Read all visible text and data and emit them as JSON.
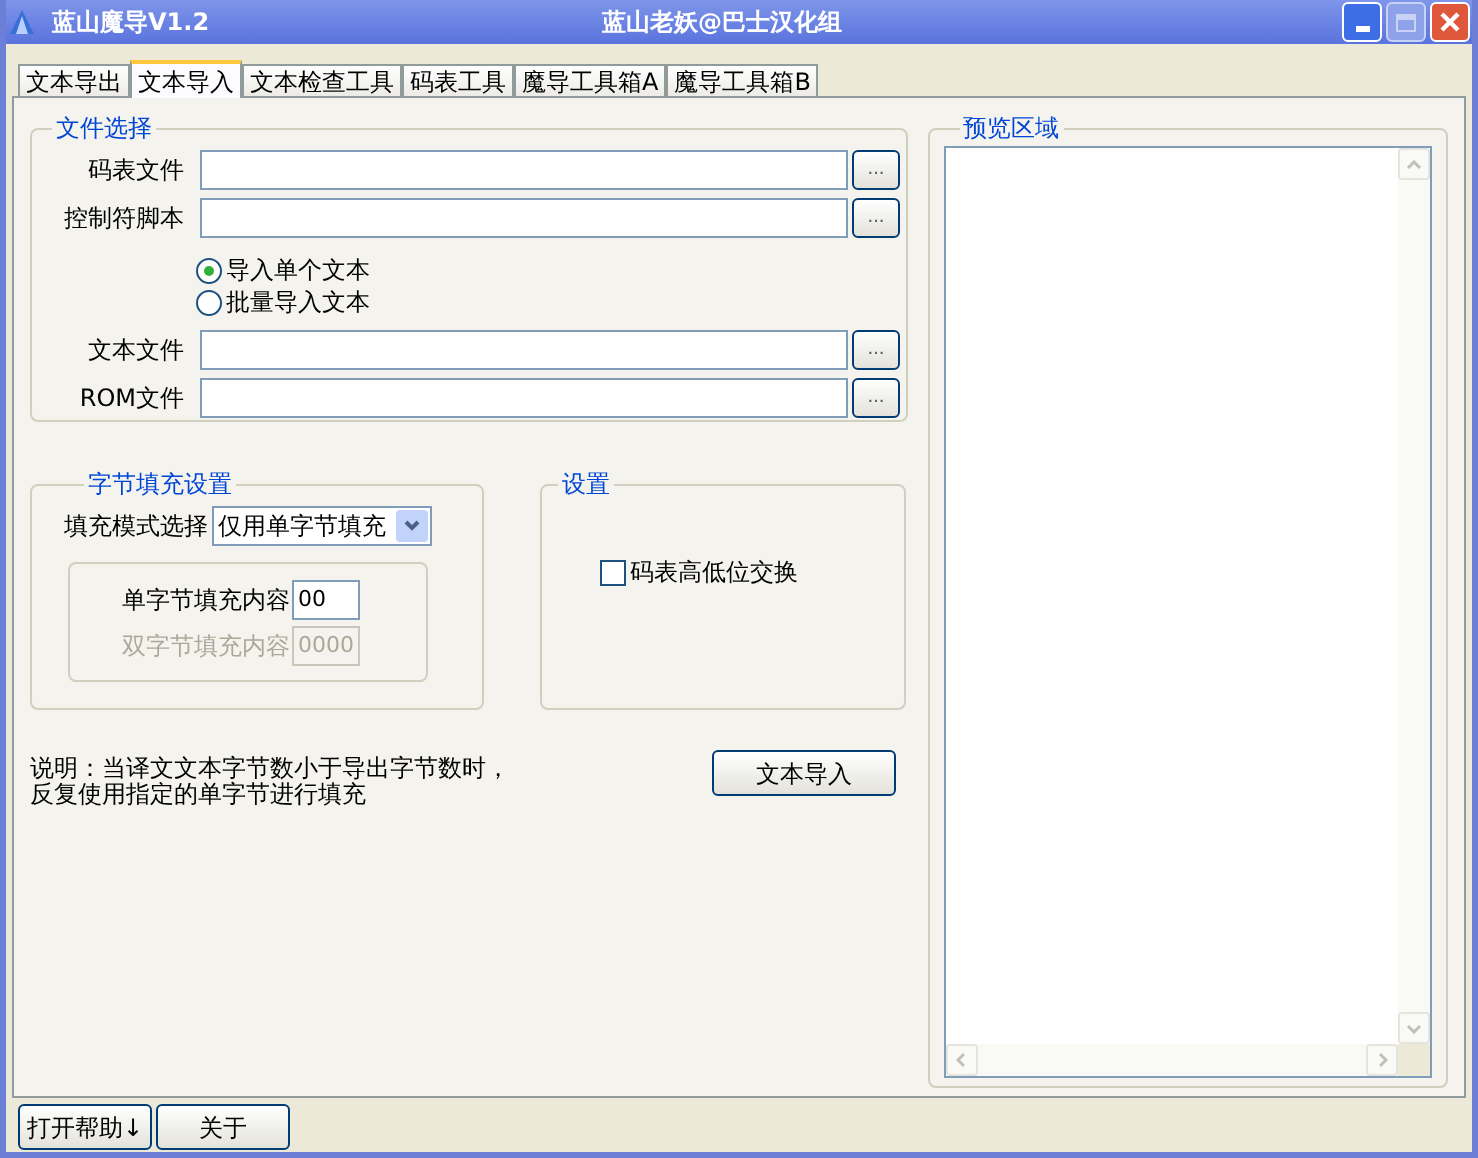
{
  "window": {
    "title": "蓝山魔导V1.2",
    "subtitle": "蓝山老妖@巴士汉化组"
  },
  "tabs": [
    {
      "label": "文本导出",
      "selected": false
    },
    {
      "label": "文本导入",
      "selected": true
    },
    {
      "label": "文本检查工具",
      "selected": false
    },
    {
      "label": "码表工具",
      "selected": false
    },
    {
      "label": "魔导工具箱A",
      "selected": false
    },
    {
      "label": "魔导工具箱B",
      "selected": false
    }
  ],
  "file_group": {
    "title": "文件选择",
    "fields_top": [
      {
        "label": "码表文件",
        "button": "..."
      },
      {
        "label": "控制符脚本",
        "button": "..."
      }
    ],
    "radios": [
      {
        "label": "导入单个文本",
        "selected": true
      },
      {
        "label": "批量导入文本",
        "selected": false
      }
    ],
    "fields_bottom": [
      {
        "label": "文本文件",
        "button": "..."
      },
      {
        "label": "ROM文件",
        "button": "..."
      }
    ]
  },
  "fill_group": {
    "title": "字节填充设置",
    "mode_label": "填充模式选择",
    "mode_value": "仅用单字节填充",
    "fields": [
      {
        "label": "单字节填充内容",
        "value": "00",
        "disabled": false
      },
      {
        "label": "双字节填充内容",
        "value": "0000",
        "disabled": true
      }
    ]
  },
  "settings_group": {
    "title": "设置",
    "checkbox": {
      "label": "码表高低位交换",
      "checked": false
    }
  },
  "note": [
    "说明：当译文文本字节数小于导出字节数时，",
    "反复使用指定的单字节进行填充"
  ],
  "import_button": "文本导入",
  "preview": {
    "title": "预览区域"
  },
  "bottom_buttons": [
    "打开帮助↓",
    "关于"
  ]
}
